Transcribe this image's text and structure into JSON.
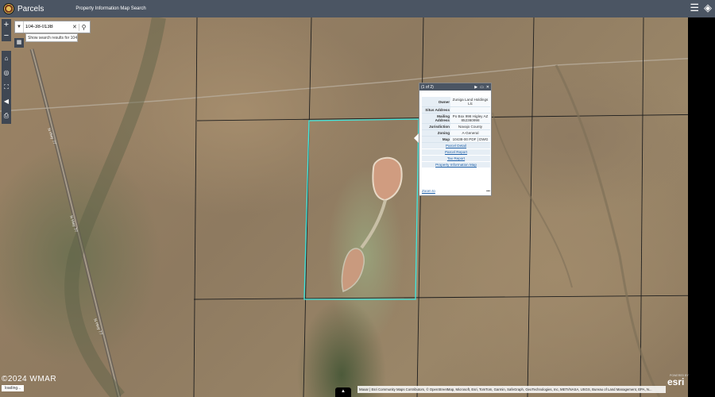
{
  "topbar": {
    "app_title": "Parcels",
    "subtitle": "Property Information Map Search",
    "list_icon": "list-icon",
    "layers_icon": "layers-icon"
  },
  "toolbar": {
    "zoom_in": "+",
    "zoom_out": "−",
    "home": "⌂",
    "locate": "◎",
    "extent": "⛶",
    "back": "◀",
    "print": "⎙"
  },
  "search": {
    "value": "104-38-013B",
    "suggestion": "Show search results for 104-38-..."
  },
  "map": {
    "road_labels": [
      "N Hwy 77",
      "N Hwy 77",
      "N Hwy 77"
    ]
  },
  "popup": {
    "pager": "(1 of 2)",
    "rows": [
      {
        "key": "Owner",
        "value": "Zuniga Land Holdings Llc"
      },
      {
        "key": "Situs Address",
        "value": ""
      },
      {
        "key": "Mailing Address",
        "value": "Po Box 998 Higley AZ 852360998"
      },
      {
        "key": "Jurisdiction",
        "value": "Navajo County"
      },
      {
        "key": "Zoning",
        "value": "A-General"
      },
      {
        "key": "Map",
        "value": "10438-00 PDF | DWG"
      }
    ],
    "links": [
      "Parcel Detail",
      "Parcel Report",
      "Tax Report",
      "Property Information Map"
    ],
    "zoom_to": "Zoom to",
    "more": "•••"
  },
  "bottom": {
    "attribution": "Maxar | Esri Community Maps Contributors, © OpenStreetMap, Microsoft, Esri, TomTom, Garmin, SafeGraph, GeoTechnologies, Inc, METI/NASA, USGS, Bureau of Land Management, EPA, N...",
    "esri": "esri",
    "esri_small": "POWERED BY",
    "watermark": "©2024 WMAR",
    "loading": "loading..."
  },
  "colors": {
    "topbar": "#4b5563",
    "parcel_outline": "#3ee8e0",
    "link": "#1d5fa8"
  }
}
